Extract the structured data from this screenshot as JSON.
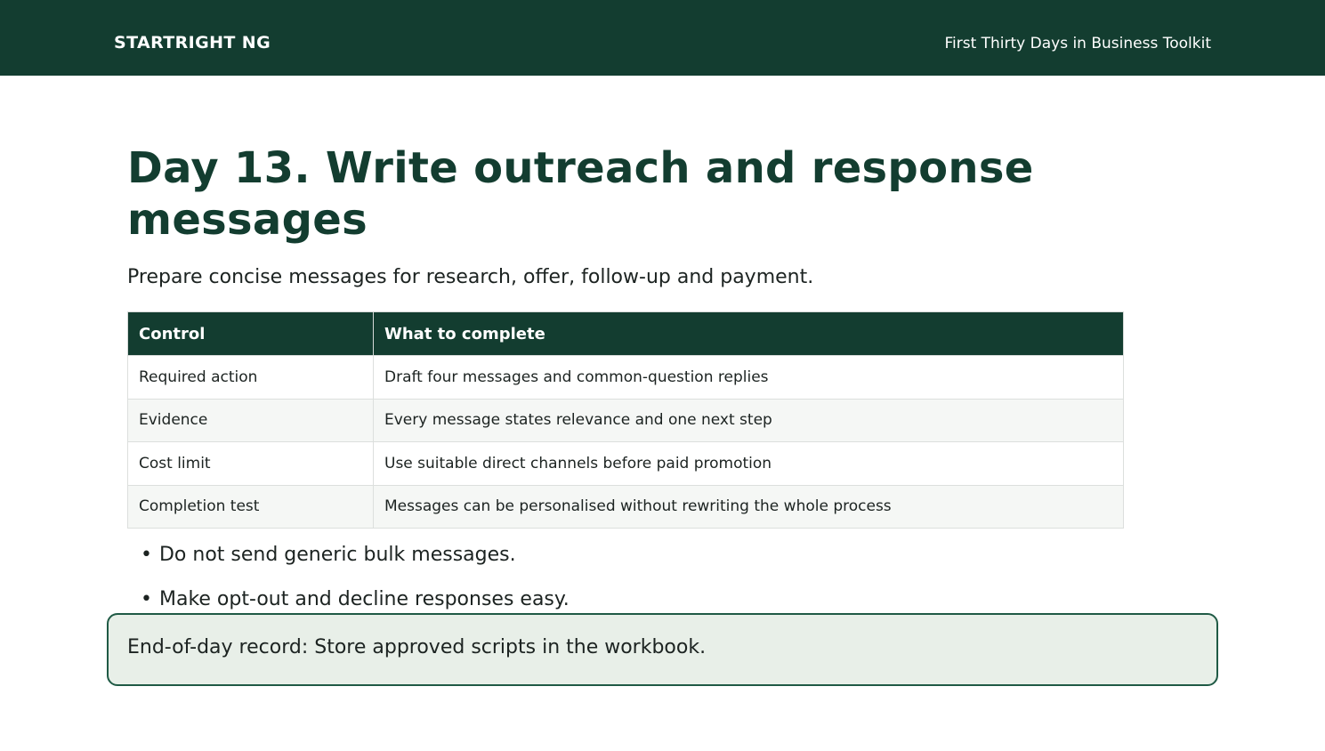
{
  "header": {
    "brand": "STARTRIGHT NG",
    "toolkit_title": "First Thirty Days in Business Toolkit"
  },
  "page": {
    "title": "Day 13. Write outreach and response messages",
    "subtitle": "Prepare concise messages for research, offer, follow-up and payment."
  },
  "table": {
    "headers": [
      "Control",
      "What to complete"
    ],
    "rows": [
      [
        "Required action",
        "Draft four messages and common-question replies"
      ],
      [
        "Evidence",
        "Every message states relevance and one next step"
      ],
      [
        "Cost limit",
        "Use suitable direct channels before paid promotion"
      ],
      [
        "Completion test",
        "Messages can be personalised without rewriting the whole process"
      ]
    ]
  },
  "bullets": [
    "Do not send generic bulk messages.",
    "Make opt-out and decline responses easy."
  ],
  "record": {
    "text": "End-of-day record: Store approved scripts in the workbook."
  },
  "colors": {
    "brand_green": "#133d30",
    "record_bg": "#e8efe8",
    "record_border": "#1f5a45"
  }
}
